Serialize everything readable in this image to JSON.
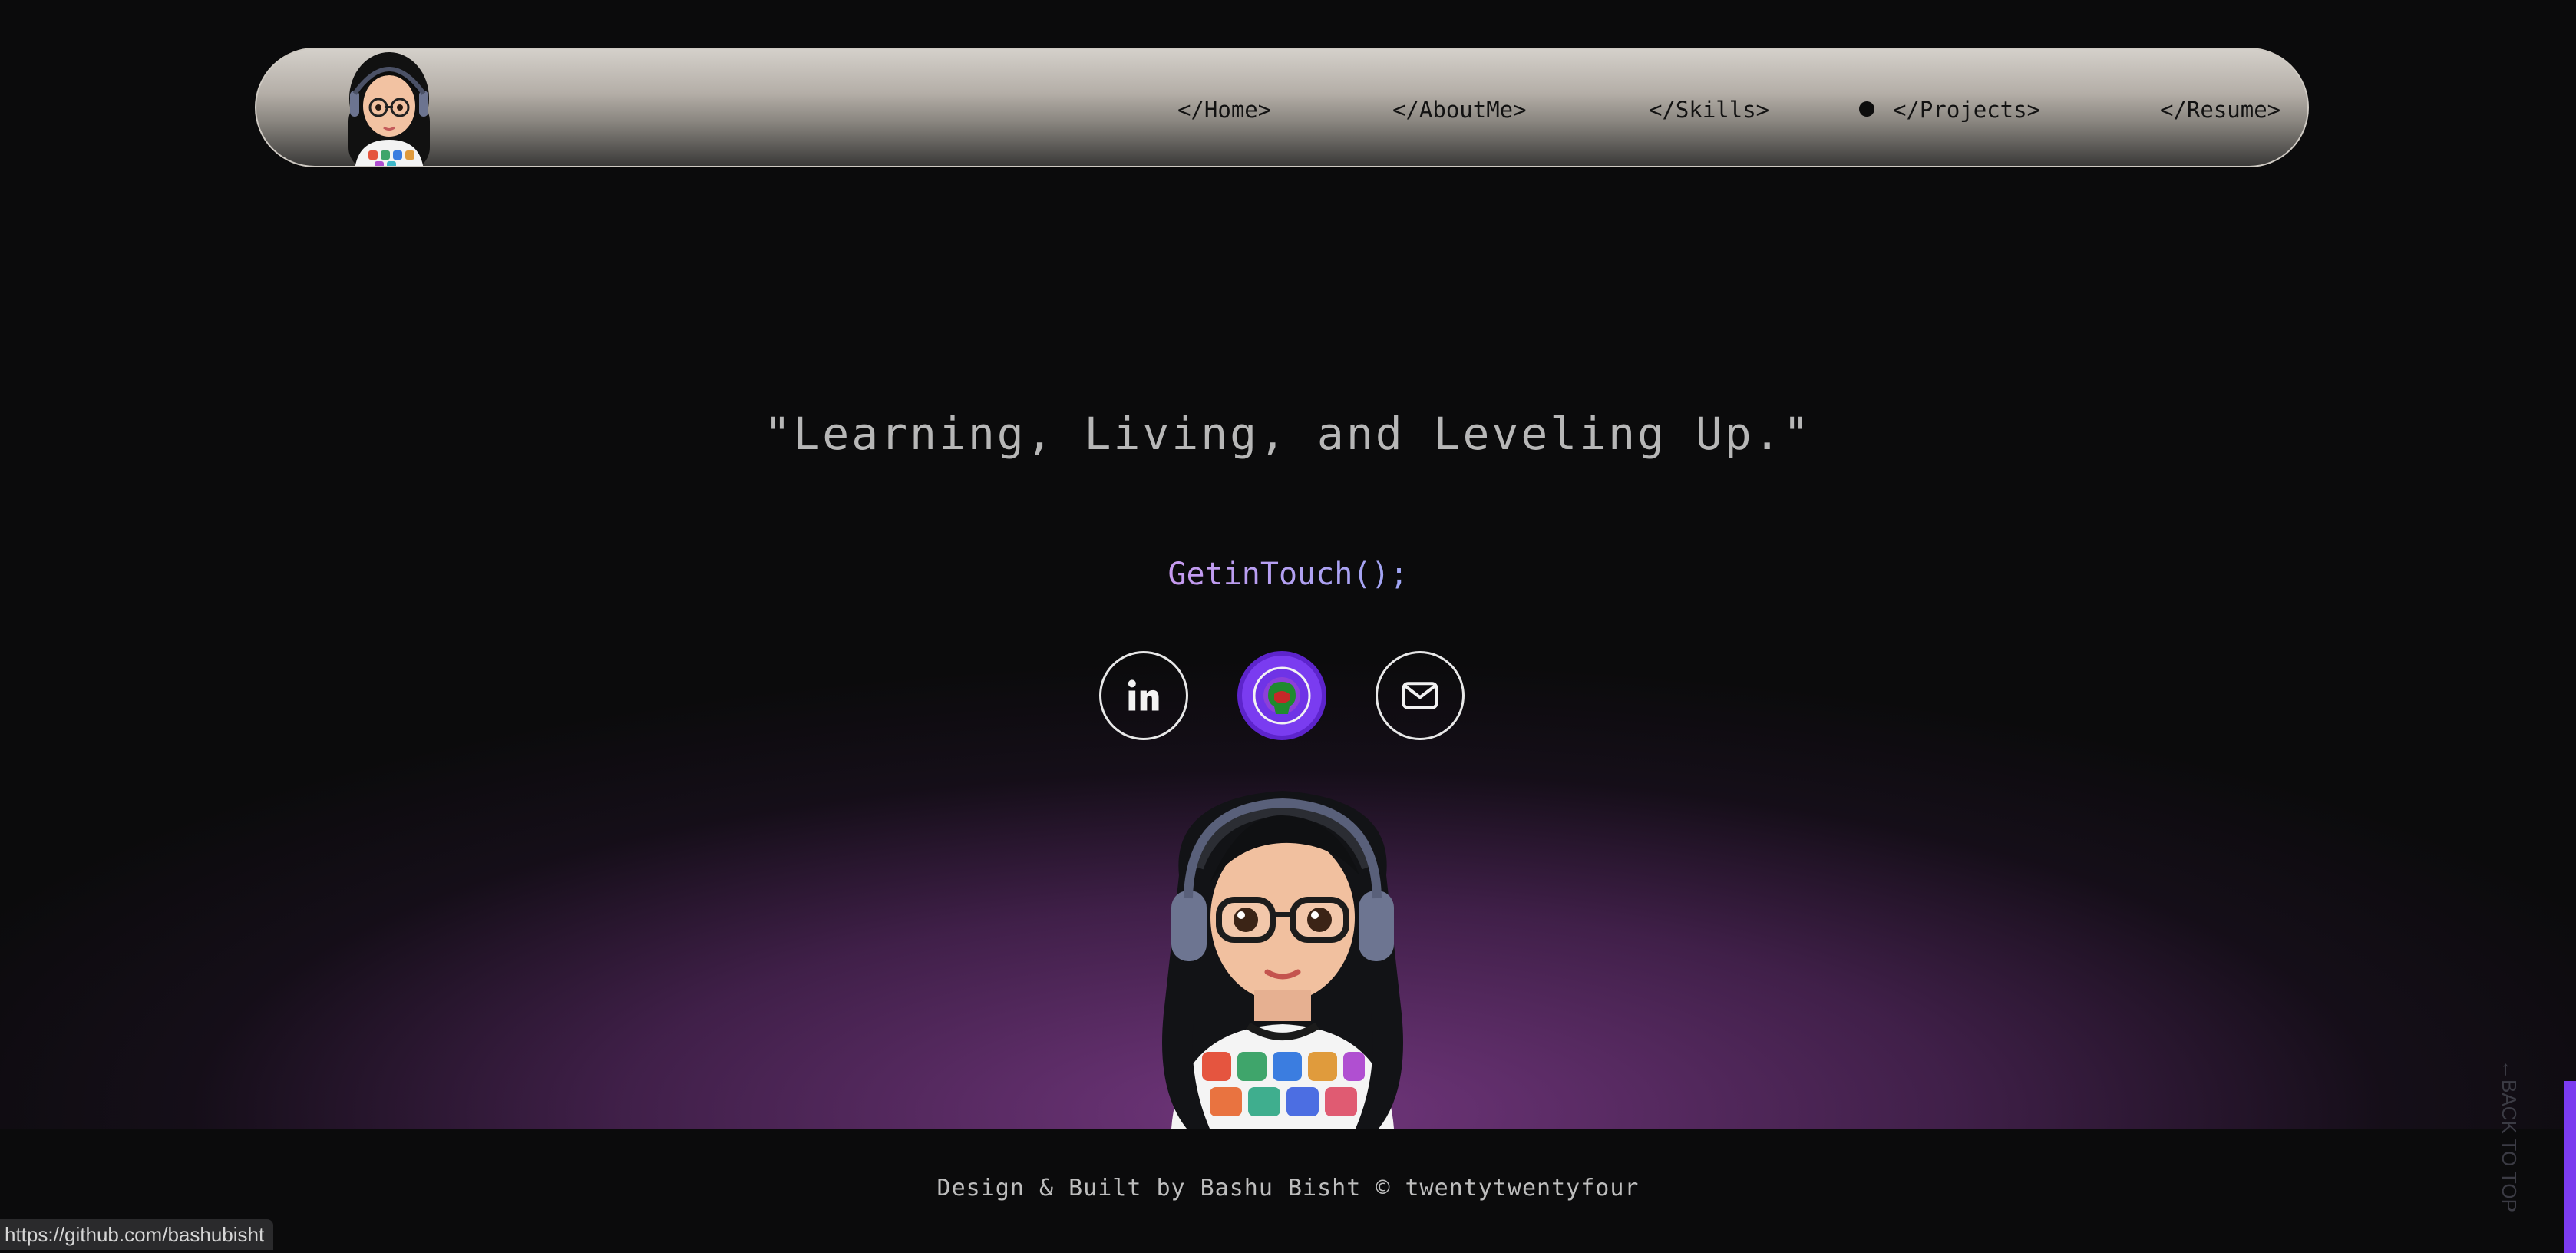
{
  "nav": {
    "items": [
      {
        "label": "</Home>",
        "active": false
      },
      {
        "label": "</AboutMe>",
        "active": false
      },
      {
        "label": "</Skills>",
        "active": false
      },
      {
        "label": "</Projects>",
        "active": true
      },
      {
        "label": "</Resume>",
        "active": false
      }
    ]
  },
  "hero": {
    "quote": "\"Learning, Living, and Leveling Up.\"",
    "cta": "GetinTouch();"
  },
  "social": [
    {
      "name": "linkedin-icon"
    },
    {
      "name": "github-icon"
    },
    {
      "name": "mail-icon"
    }
  ],
  "footer": {
    "text": "Design & Built by Bashu Bisht © twentytwentyfour"
  },
  "back_to_top": "←BACK TO TOP",
  "status_url": "https://github.com/bashubisht",
  "colors": {
    "accent": "#7a3cf0",
    "glow": "#76387f",
    "background": "#0b0b0c"
  }
}
